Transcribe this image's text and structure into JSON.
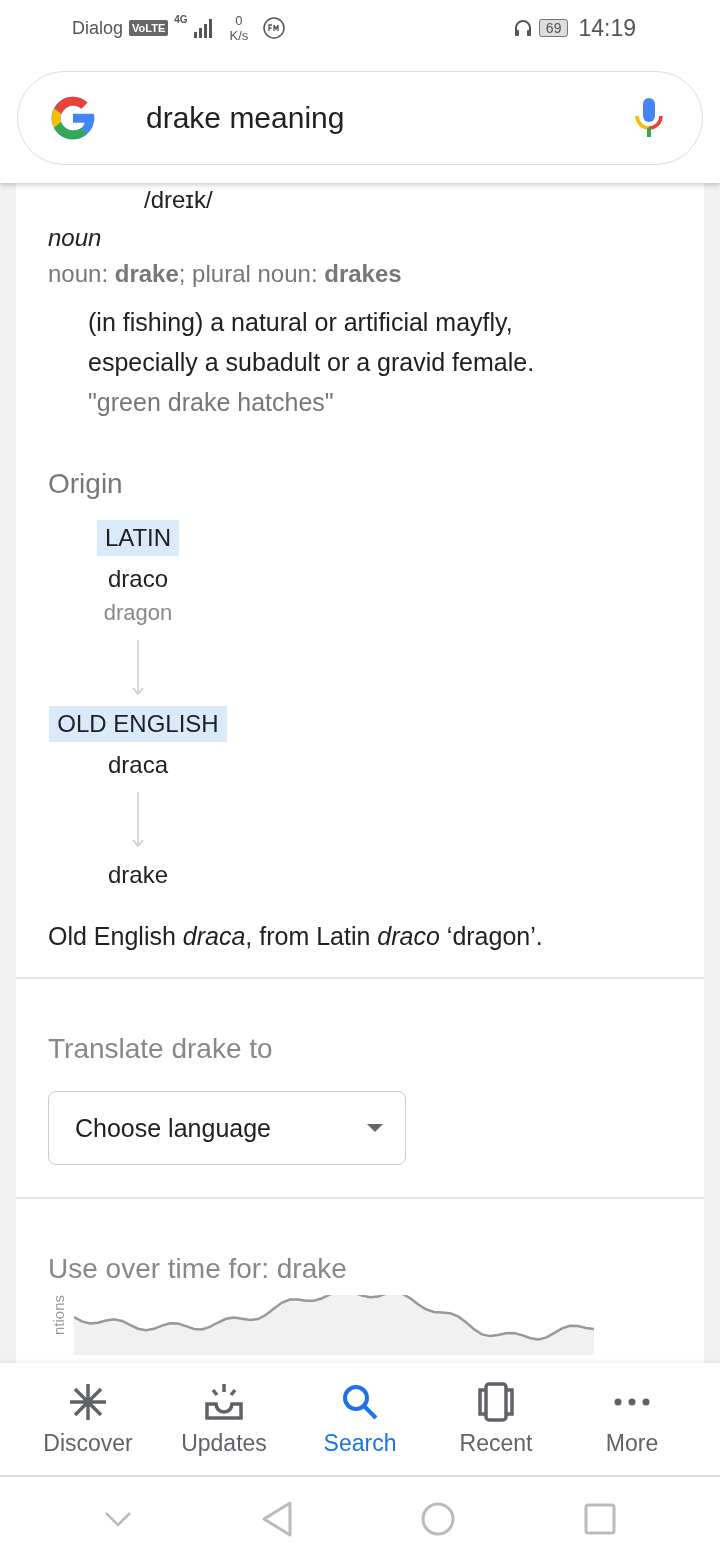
{
  "status_bar": {
    "carrier": "Dialog",
    "volte": "VoLTE",
    "network": "4G",
    "speed_value": "0",
    "speed_unit": "K/s",
    "battery": "69",
    "time": "14:19"
  },
  "search": {
    "value": "drake meaning"
  },
  "definition": {
    "pronunciation": "/dreɪk/",
    "part_of_speech": "noun",
    "forms": "noun: **drake**; plural noun: **drakes**",
    "meaning": "(in fishing) a natural or artificial mayfly, especially a subadult or a gravid female.",
    "example": "\"green drake hatches\""
  },
  "origin": {
    "title": "Origin",
    "nodes": [
      {
        "language": "LATIN",
        "word": "draco",
        "gloss": "dragon"
      },
      {
        "language": "OLD ENGLISH",
        "word": "draca"
      },
      {
        "word": "drake"
      }
    ],
    "summary": "Old English *draca*, from Latin *draco* ‘dragon’."
  },
  "translate": {
    "title": "Translate drake to",
    "dropdown": "Choose language"
  },
  "usage": {
    "title": "Use over time for: drake",
    "y_label": "ntions"
  },
  "bottom_nav": [
    {
      "label": "Discover",
      "selected": false
    },
    {
      "label": "Updates",
      "selected": false
    },
    {
      "label": "Search",
      "selected": true
    },
    {
      "label": "Recent",
      "selected": false
    },
    {
      "label": "More",
      "selected": false
    }
  ]
}
